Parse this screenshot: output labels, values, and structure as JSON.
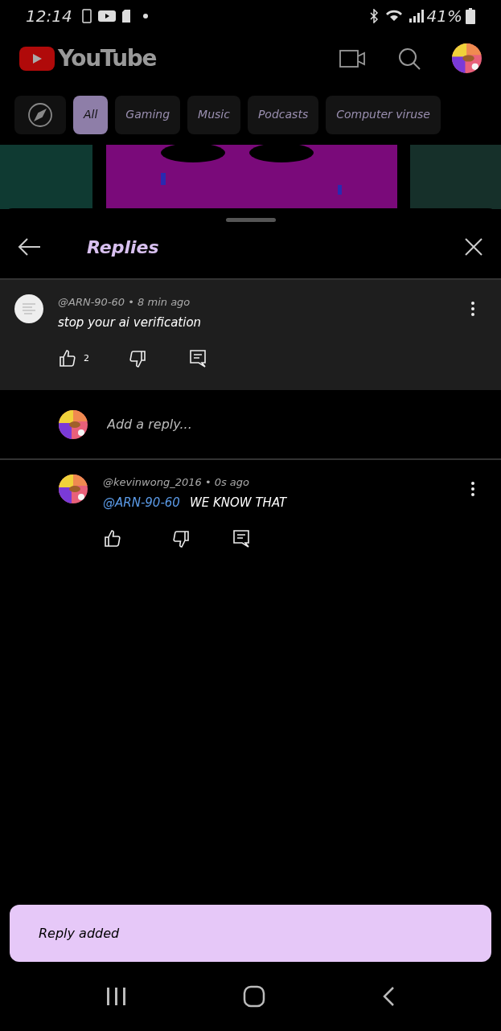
{
  "status_bar": {
    "time": "12:14",
    "battery": "41%"
  },
  "header": {
    "logo": "YouTube"
  },
  "chips": [
    {
      "label": "All",
      "selected": true
    },
    {
      "label": "Gaming",
      "selected": false
    },
    {
      "label": "Music",
      "selected": false
    },
    {
      "label": "Podcasts",
      "selected": false
    },
    {
      "label": "Computer viruse",
      "selected": false
    }
  ],
  "sheet": {
    "title": "Replies"
  },
  "comment": {
    "author": "@ARN-90-60",
    "separator": "•",
    "time": "8 min ago",
    "text": "stop your ai verification",
    "likes": "2"
  },
  "reply_field": {
    "placeholder": "Add a reply..."
  },
  "replies": [
    {
      "author": "@kevinwong_2016",
      "separator": "•",
      "time": "0s ago",
      "mention": "@ARN-90-60",
      "text": "WE KNOW THAT"
    }
  ],
  "toast": "Reply added"
}
